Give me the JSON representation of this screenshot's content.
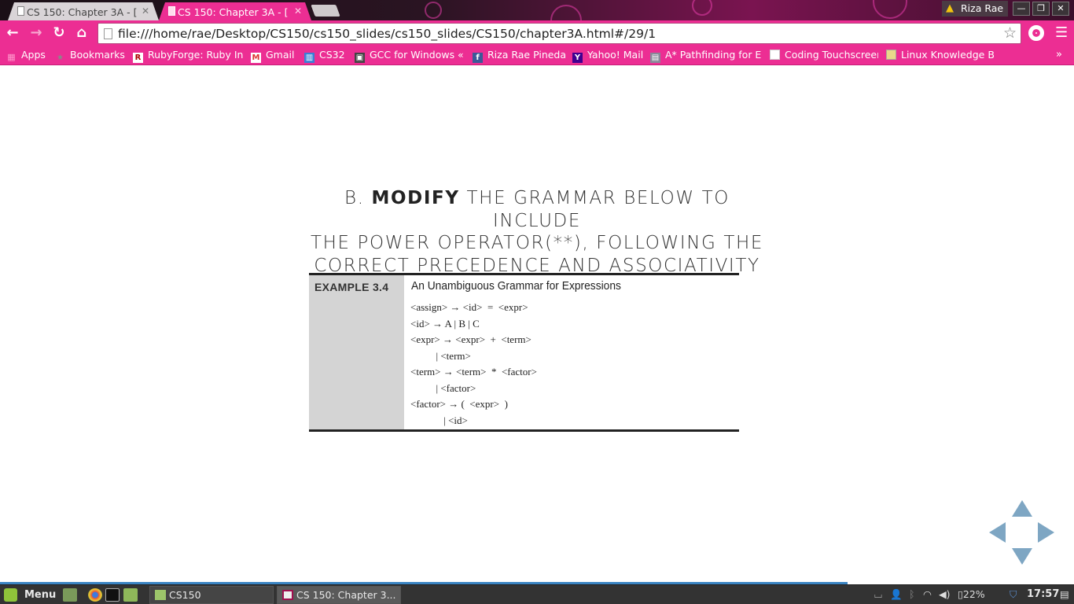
{
  "browser": {
    "tabs": [
      {
        "title": "CS 150: Chapter 3A - [",
        "active": false
      },
      {
        "title": "CS 150: Chapter 3A - [",
        "active": true
      }
    ],
    "profile_name": "Riza Rae",
    "url": "file:///home/rae/Desktop/CS150/cs150_slides/cs150_slides/CS150/chapter3A.html#/29/1",
    "bookmarks": [
      {
        "label": "Apps",
        "icon": "apps-grid-icon"
      },
      {
        "label": "Bookmarks",
        "icon": "star-icon"
      },
      {
        "label": "RubyForge: Ruby In",
        "icon": "rubyforge-icon"
      },
      {
        "label": "Gmail",
        "icon": "gmail-icon"
      },
      {
        "label": "CS32",
        "icon": "trello-icon"
      },
      {
        "label": "GCC for Windows «",
        "icon": "gcc-icon"
      },
      {
        "label": "Riza Rae Pineda",
        "icon": "facebook-icon"
      },
      {
        "label": "Yahoo! Mail",
        "icon": "yahoo-icon"
      },
      {
        "label": "A* Pathfinding for E",
        "icon": "image-icon"
      },
      {
        "label": "Coding Touchscreen",
        "icon": "page-icon"
      },
      {
        "label": "Linux Knowledge B",
        "icon": "page-icon"
      }
    ],
    "colors": {
      "accent": "#ec2e93",
      "nav_arrow": "#7ea6c3"
    }
  },
  "slide": {
    "heading_prefix": "B.",
    "heading_bold": "MODIFY",
    "heading_rest_line1": "THE GRAMMAR BELOW TO INCLUDE",
    "heading_line2": "THE POWER OPERATOR(**), FOLLOWING THE",
    "heading_line3": "CORRECT PRECEDENCE AND ASSOCIATIVITY",
    "figure": {
      "label": "EXAMPLE 3.4",
      "title": "An Unambiguous Grammar for Expressions",
      "rules": [
        "<assign> → <id>  =  <expr>",
        "<id> → A | B | C",
        "<expr> → <expr>  +  <term>",
        "          | <term>",
        "<term> → <term>  *  <factor>",
        "          | <factor>",
        "<factor> → (  <expr>  )",
        "             | <id>"
      ]
    }
  },
  "taskbar": {
    "menu_label": "Menu",
    "tasks": [
      {
        "label": "CS150",
        "icon": "folder-icon"
      },
      {
        "label": "CS 150: Chapter 3...",
        "icon": "chrome-window-icon"
      }
    ],
    "battery": "22%",
    "clock": "17:57"
  }
}
